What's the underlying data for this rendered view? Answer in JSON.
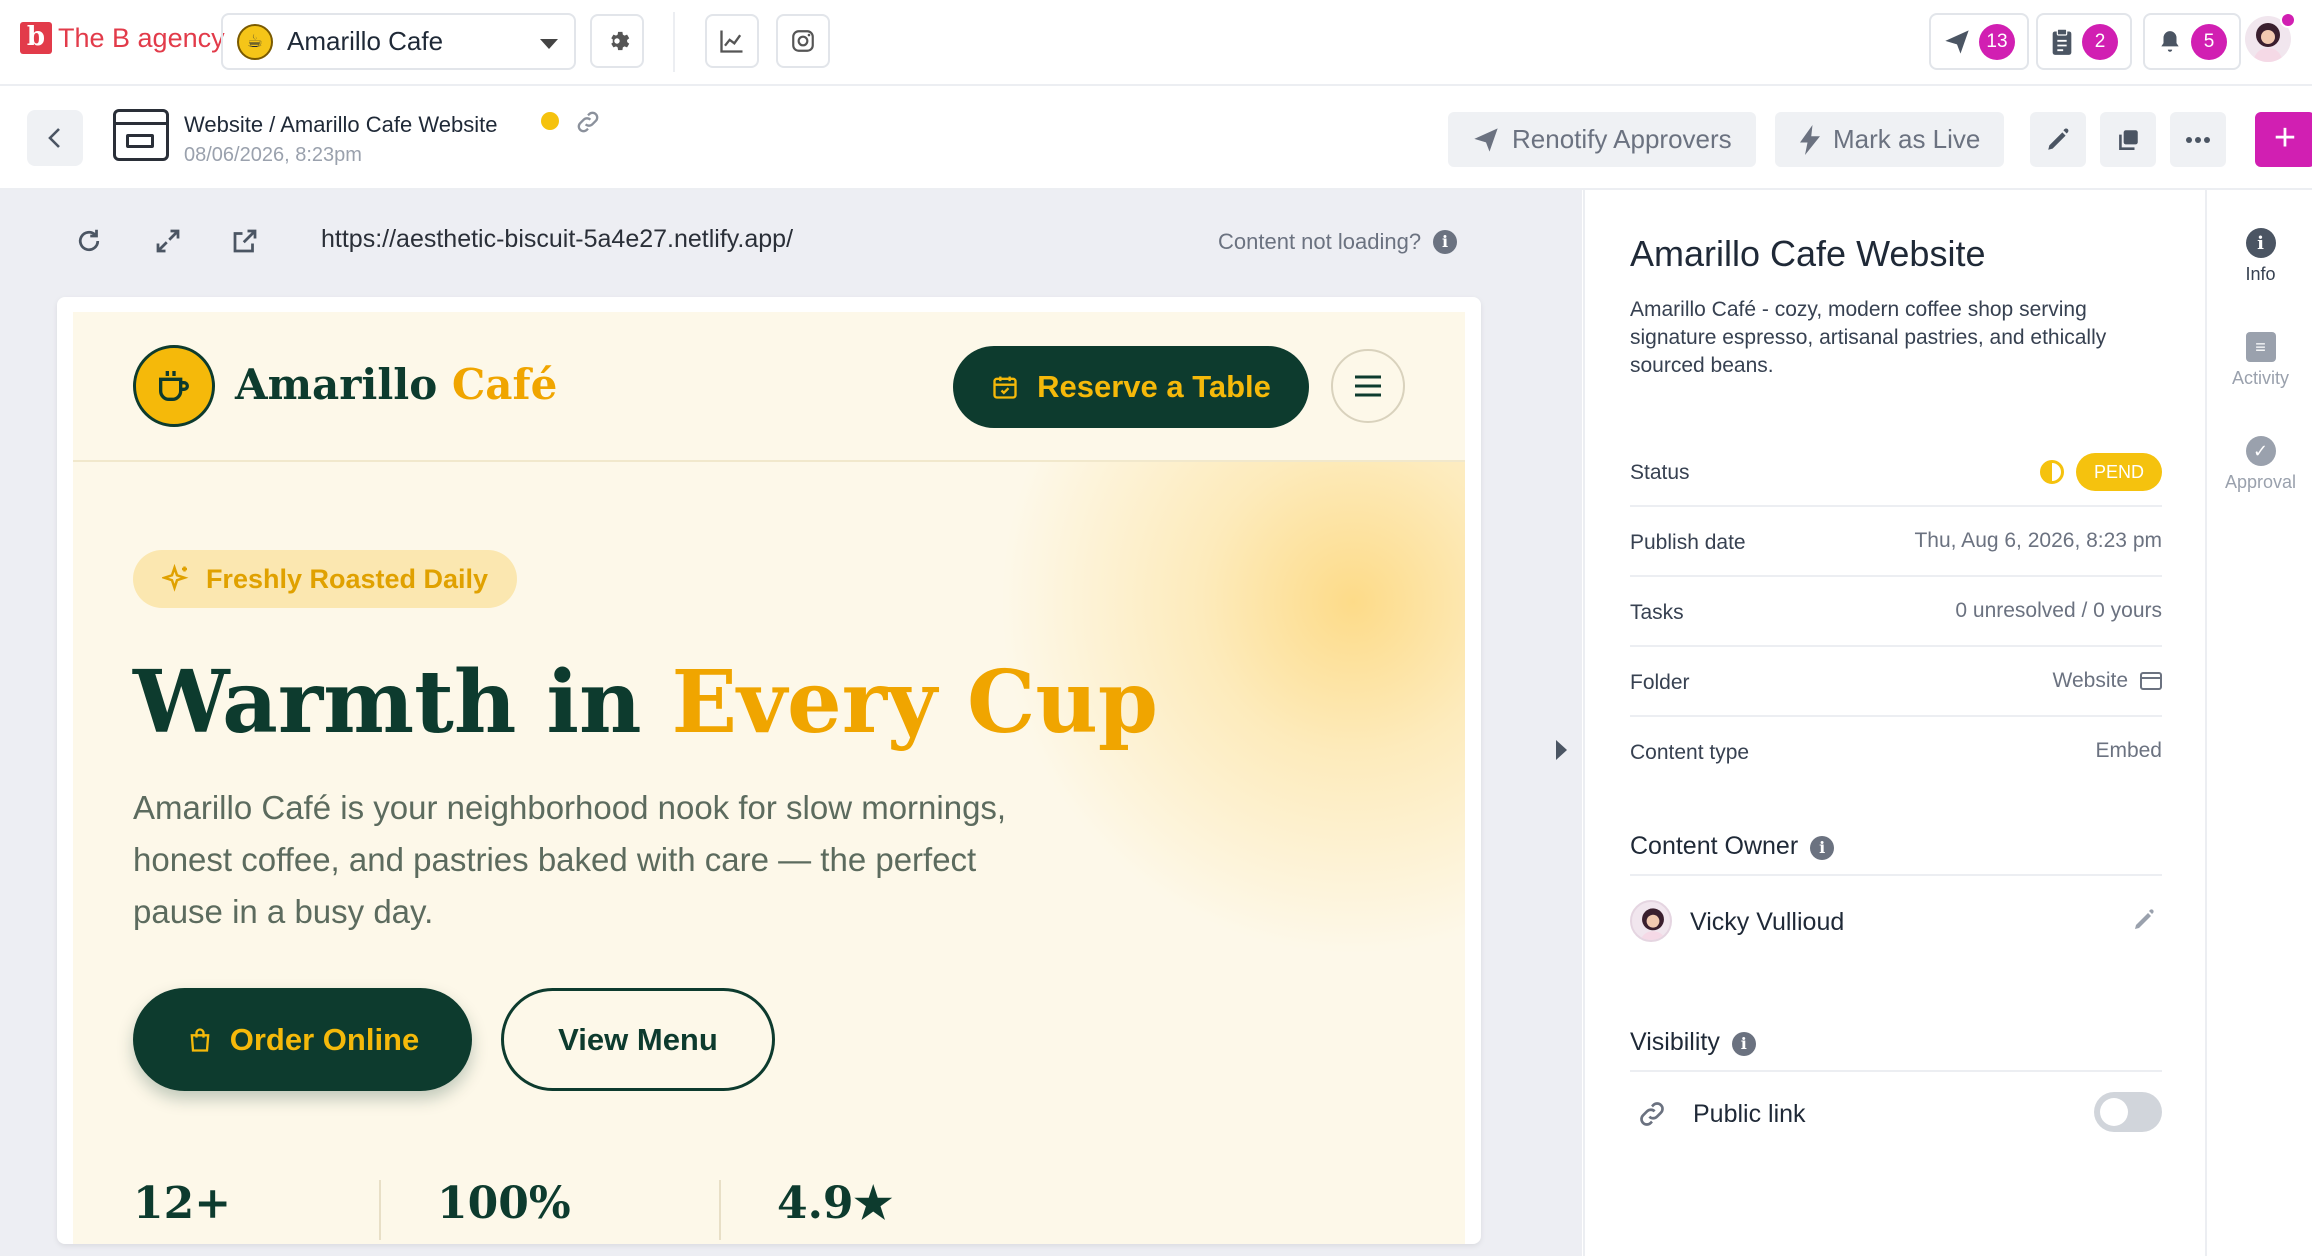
{
  "topbar": {
    "brand_logo": "b",
    "brand_name": "The B agency",
    "client_name": "Amarillo Cafe",
    "notifications": [
      {
        "icon": "send-icon",
        "count": "13"
      },
      {
        "icon": "clipboard-icon",
        "count": "2"
      },
      {
        "icon": "bell-icon",
        "count": "5"
      }
    ]
  },
  "header": {
    "breadcrumb": "Website / Amarillo Cafe Website",
    "date": "08/06/2026, 8:23pm",
    "renotify_label": "Renotify Approvers",
    "mark_live_label": "Mark as Live",
    "plus_label": "+"
  },
  "preview": {
    "url": "https://aesthetic-biscuit-5a4e27.netlify.app/",
    "not_loading": "Content not loading?",
    "info_glyph": "i"
  },
  "site": {
    "name_part1": "Amarillo",
    "name_part2": "Café",
    "reserve_label": "Reserve a Table",
    "tag": "Freshly Roasted Daily",
    "hero_part1": "Warmth in",
    "hero_part2": "Every Cup",
    "hero_sub": "Amarillo Café is your neighborhood nook for slow mornings, honest coffee, and pastries baked with care — the perfect pause in a busy day.",
    "order_label": "Order Online",
    "menu_label": "View Menu",
    "stats": [
      "12+",
      "100%",
      "4.9★"
    ]
  },
  "info": {
    "title": "Amarillo Cafe Website",
    "description": "Amarillo Café - cozy, modern coffee shop serving signature espresso, artisanal pastries, and ethically sourced beans.",
    "status_label": "Status",
    "status_value": "PEND",
    "publish_label": "Publish date",
    "publish_value": "Thu, Aug 6, 2026, 8:23 pm",
    "tasks_label": "Tasks",
    "tasks_value": "0 unresolved / 0 yours",
    "folder_label": "Folder",
    "folder_value": "Website",
    "type_label": "Content type",
    "type_value": "Embed",
    "owner_heading": "Content Owner",
    "owner_name": "Vicky Vullioud",
    "visibility_heading": "Visibility",
    "public_link_label": "Public link",
    "public_link_on": false
  },
  "rail": {
    "info": "Info",
    "activity": "Activity",
    "approval": "Approval"
  },
  "colors": {
    "brand": "#e23b4a",
    "accent": "#d11fb2",
    "pending": "#f5c20e",
    "cafe_green": "#0d3b2e",
    "cafe_gold": "#f0a500"
  }
}
